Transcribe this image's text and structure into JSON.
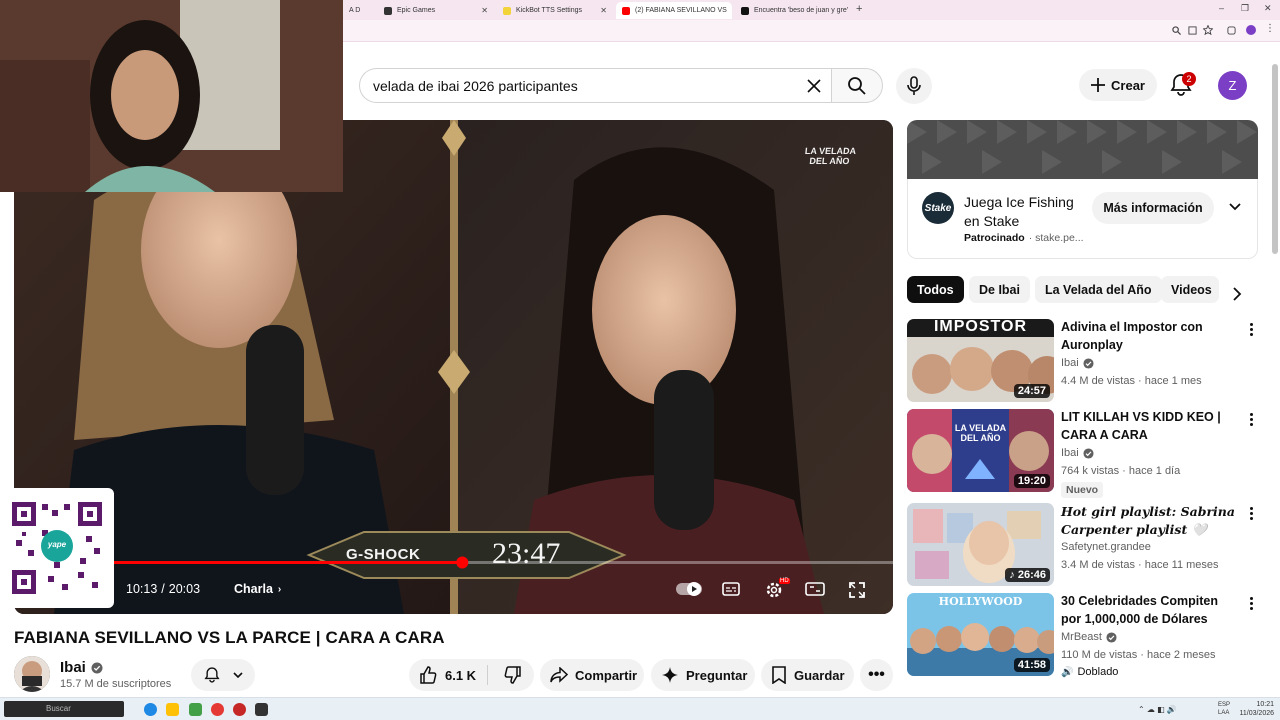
{
  "browser": {
    "tabs": [
      {
        "label": "A D",
        "color": "#7d5cd6",
        "active": false
      },
      {
        "label": "Epic Games",
        "color": "#333333",
        "active": false
      },
      {
        "label": "KickBot TTS Settings",
        "color": "#f2d43a",
        "active": false
      },
      {
        "label": "(2) FABIANA SEVILLANO VS",
        "color": "#ff0000",
        "active": true
      },
      {
        "label": "Encuentra 'beso de juan y gre'",
        "color": "#111111",
        "active": false
      }
    ],
    "new_tab": "+",
    "window_controls": [
      "–",
      "❐",
      "✕"
    ]
  },
  "header": {
    "search_query": "velada de ibai 2026 participantes",
    "create_label": "Crear",
    "notifications_count": "2",
    "user_initial": "Z"
  },
  "player": {
    "watermark": "LA VELADA DEL AÑO",
    "lower_third_brand": "G-SHOCK",
    "lower_third_time": "23:47",
    "time_current": "10:13",
    "time_separator": "/",
    "time_total": "20:03",
    "chapter": "Charla",
    "progress": 0.51,
    "qr_label": "yape"
  },
  "video": {
    "title": "FABIANA SEVILLANO VS LA PARCE | CARA A CARA",
    "channel": "Ibai",
    "subscribers": "15.7 M de suscriptores",
    "likes": "6.1 K",
    "share_label": "Compartir",
    "ask_label": "Preguntar",
    "save_label": "Guardar"
  },
  "ad": {
    "title_line1": "Juega Ice Fishing",
    "title_line2": "en Stake",
    "sponsored": "Patrocinado",
    "domain": "· stake.pe...",
    "cta": "Más información",
    "logo_text": "Stake"
  },
  "chips": [
    {
      "label": "Todos",
      "active": true
    },
    {
      "label": "De Ibai",
      "active": false
    },
    {
      "label": "La Velada del Año",
      "active": false
    },
    {
      "label": "Videos",
      "active": false
    }
  ],
  "recommendations": [
    {
      "title": "Adivina el Impostor con Auronplay",
      "channel": "Ibai",
      "verified": true,
      "meta": "4.4 M de vistas · hace 1 mes",
      "duration": "24:57",
      "thumb_text": "IMPOSTOR",
      "badge": ""
    },
    {
      "title": "LIT KILLAH VS KIDD KEO | CARA A CARA",
      "channel": "Ibai",
      "verified": true,
      "meta": "764 k vistas · hace 1 día",
      "duration": "19:20",
      "thumb_text": "LA VELADA DEL AÑO",
      "badge": "Nuevo"
    },
    {
      "title": "Hot girl playlist: Sabrina Carpenter playlist 🤍",
      "channel": "Safetynet.grandee",
      "verified": false,
      "meta": "3.4 M de vistas · hace 11 meses",
      "duration": "♪ 26:46",
      "thumb_text": "",
      "badge": ""
    },
    {
      "title": "30 Celebridades Compiten por 1,000,000 de Dólares",
      "channel": "MrBeast",
      "verified": true,
      "meta": "110 M de vistas · hace 2 meses",
      "duration": "41:58",
      "thumb_text": "HOLLYWOOD",
      "badge": "Doblado"
    }
  ],
  "taskbar": {
    "search_placeholder": "Buscar",
    "lang": "ESP LAA",
    "time": "10:21",
    "date": "11/03/2026"
  },
  "colors": {
    "yt_red": "#ff0000",
    "avatar_purple": "#7b3fc6",
    "notif_red": "#cc0000"
  }
}
